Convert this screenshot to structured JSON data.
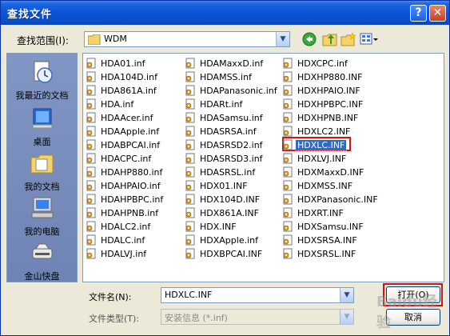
{
  "window": {
    "title": "查找文件",
    "help": "?",
    "close": "✕"
  },
  "look_in": {
    "label": "查找范围(I):",
    "value": "WDM"
  },
  "places": [
    {
      "name": "recent",
      "label": "我最近的文档"
    },
    {
      "name": "desktop",
      "label": "桌面"
    },
    {
      "name": "mydocs",
      "label": "我的文档"
    },
    {
      "name": "mycomputer",
      "label": "我的电脑"
    },
    {
      "name": "kuaipan",
      "label": "金山快盘"
    }
  ],
  "files": [
    [
      "HDA01.inf",
      "HDA104D.inf",
      "HDA861A.inf",
      "HDA.inf",
      "HDAAcer.inf",
      "HDAApple.inf",
      "HDABPCAI.inf",
      "HDACPC.inf",
      "HDAHP880.inf",
      "HDAHPAIO.inf",
      "HDAHPBPC.inf",
      "HDAHPNB.inf",
      "HDALC2.inf",
      "HDALC.inf",
      "HDALVJ.inf"
    ],
    [
      "HDAMaxxD.inf",
      "HDAMSS.inf",
      "HDAPanasonic.inf",
      "HDARt.inf",
      "HDASamsu.inf",
      "HDASRSA.inf",
      "HDASRSD2.inf",
      "HDASRSD3.inf",
      "HDASRSL.inf",
      "HDX01.INF",
      "HDX104D.INF",
      "HDX861A.INF",
      "HDX.INF",
      "HDXApple.inf",
      "HDXBPCAI.INF"
    ],
    [
      "HDXCPC.inf",
      "HDXHP880.INF",
      "HDXHPAIO.INF",
      "HDXHPBPC.INF",
      "HDXHPNB.INF",
      "HDXLC2.INF",
      "HDXLC.INF",
      "HDXLVJ.INF",
      "HDXMaxxD.INF",
      "HDXMSS.INF",
      "HDXPanasonic.INF",
      "HDXRT.INF",
      "HDXSamsu.INF",
      "HDXSRSA.INF",
      "HDXSRSL.INF"
    ]
  ],
  "selected_file": "HDXLC.INF",
  "file_name": {
    "label": "文件名(N):",
    "value": "HDXLC.INF"
  },
  "file_type": {
    "label": "文件类型(T):",
    "value": "安装信息 (*.inf)"
  },
  "buttons": {
    "open": "打开(O)",
    "cancel": "取消"
  },
  "watermark": "Baidu经验"
}
